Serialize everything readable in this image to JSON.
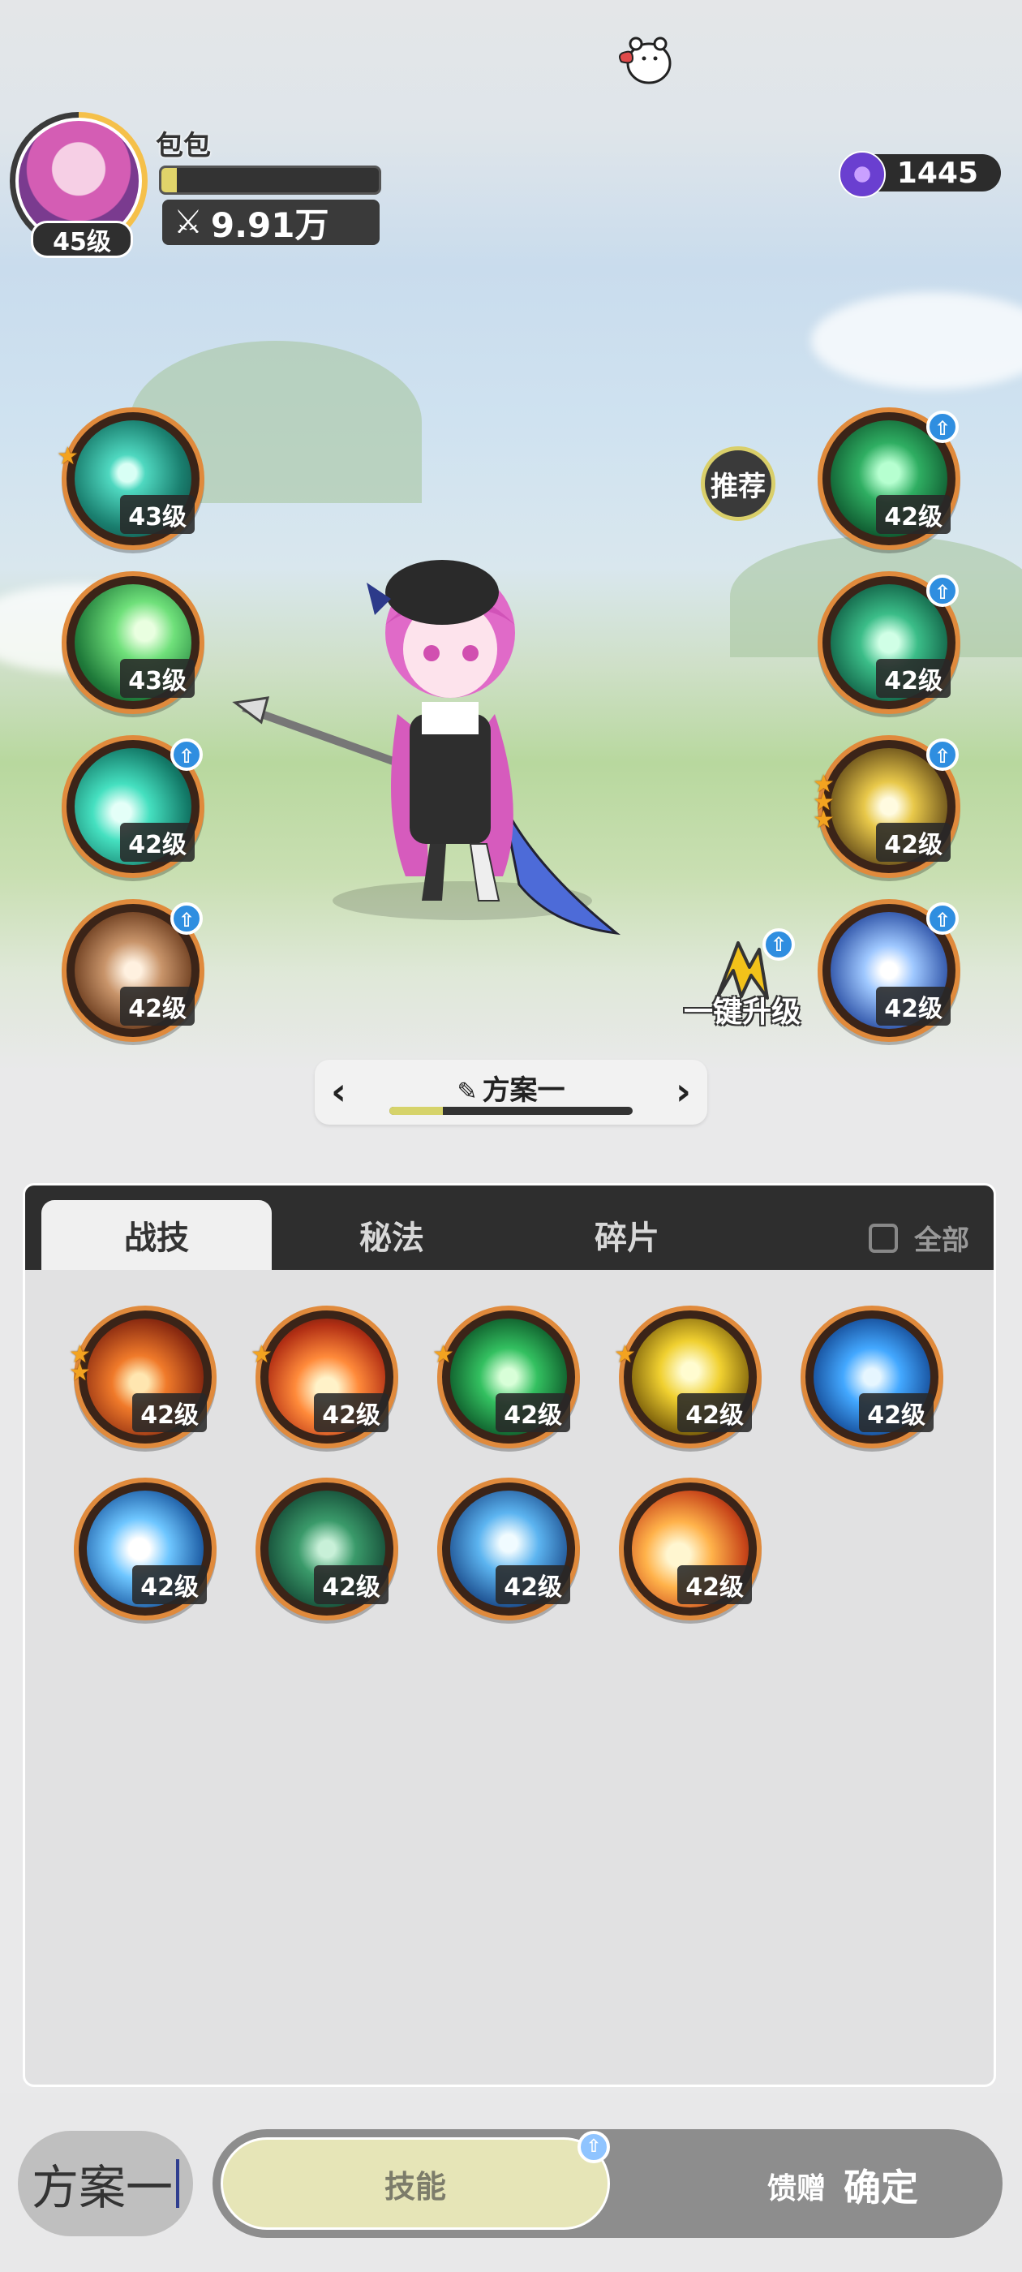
{
  "profile": {
    "name": "包包",
    "level": "45级",
    "exp_fraction": 0.07,
    "power": "9.91万"
  },
  "currency": {
    "amount": "1445"
  },
  "left_skills": [
    {
      "level": "43级",
      "stars": 1,
      "upgrade": false,
      "color": "c-teal"
    },
    {
      "level": "43级",
      "stars": 0,
      "upgrade": false,
      "color": "c-green"
    },
    {
      "level": "42级",
      "stars": 0,
      "upgrade": true,
      "color": "c-cyan"
    },
    {
      "level": "42级",
      "stars": 0,
      "upgrade": true,
      "color": "c-brown"
    }
  ],
  "right_skills": [
    {
      "level": "42级",
      "stars": 0,
      "upgrade": true,
      "color": "c-heart"
    },
    {
      "level": "42级",
      "stars": 0,
      "upgrade": true,
      "color": "c-recy"
    },
    {
      "level": "42级",
      "stars": 3,
      "upgrade": true,
      "color": "c-gold"
    },
    {
      "level": "42级",
      "stars": 0,
      "upgrade": true,
      "color": "c-ice"
    }
  ],
  "recommend_label": "推荐",
  "one_click_label": "一键升级",
  "plan": {
    "name": "方案一",
    "progress_fraction": 0.22
  },
  "tabs": [
    {
      "label": "战技",
      "active": true
    },
    {
      "label": "秘法",
      "active": false
    },
    {
      "label": "碎片",
      "active": false
    }
  ],
  "all_toggle_label": "全部",
  "grid_skills": [
    {
      "level": "42级",
      "stars": 2,
      "color": "c-fire"
    },
    {
      "level": "42级",
      "stars": 1,
      "color": "c-flame"
    },
    {
      "level": "42级",
      "stars": 1,
      "color": "c-heal"
    },
    {
      "level": "42级",
      "stars": 1,
      "color": "c-yel"
    },
    {
      "level": "42级",
      "stars": 0,
      "color": "c-blue"
    },
    {
      "level": "42级",
      "stars": 0,
      "color": "c-shard"
    },
    {
      "level": "42级",
      "stars": 0,
      "color": "c-thorn"
    },
    {
      "level": "42级",
      "stars": 0,
      "color": "c-crys"
    },
    {
      "level": "42级",
      "stars": 0,
      "color": "c-orb"
    }
  ],
  "bottom": {
    "plan_button": "方案一",
    "mode_active": "技能",
    "mode_gift": "馈赠",
    "confirm": "确定"
  },
  "colors": {
    "orb_border": "#e08a3c",
    "upgrade_badge": "#2f8ee0",
    "star": "#f3a320",
    "exp_fill": "#e0d46a"
  }
}
